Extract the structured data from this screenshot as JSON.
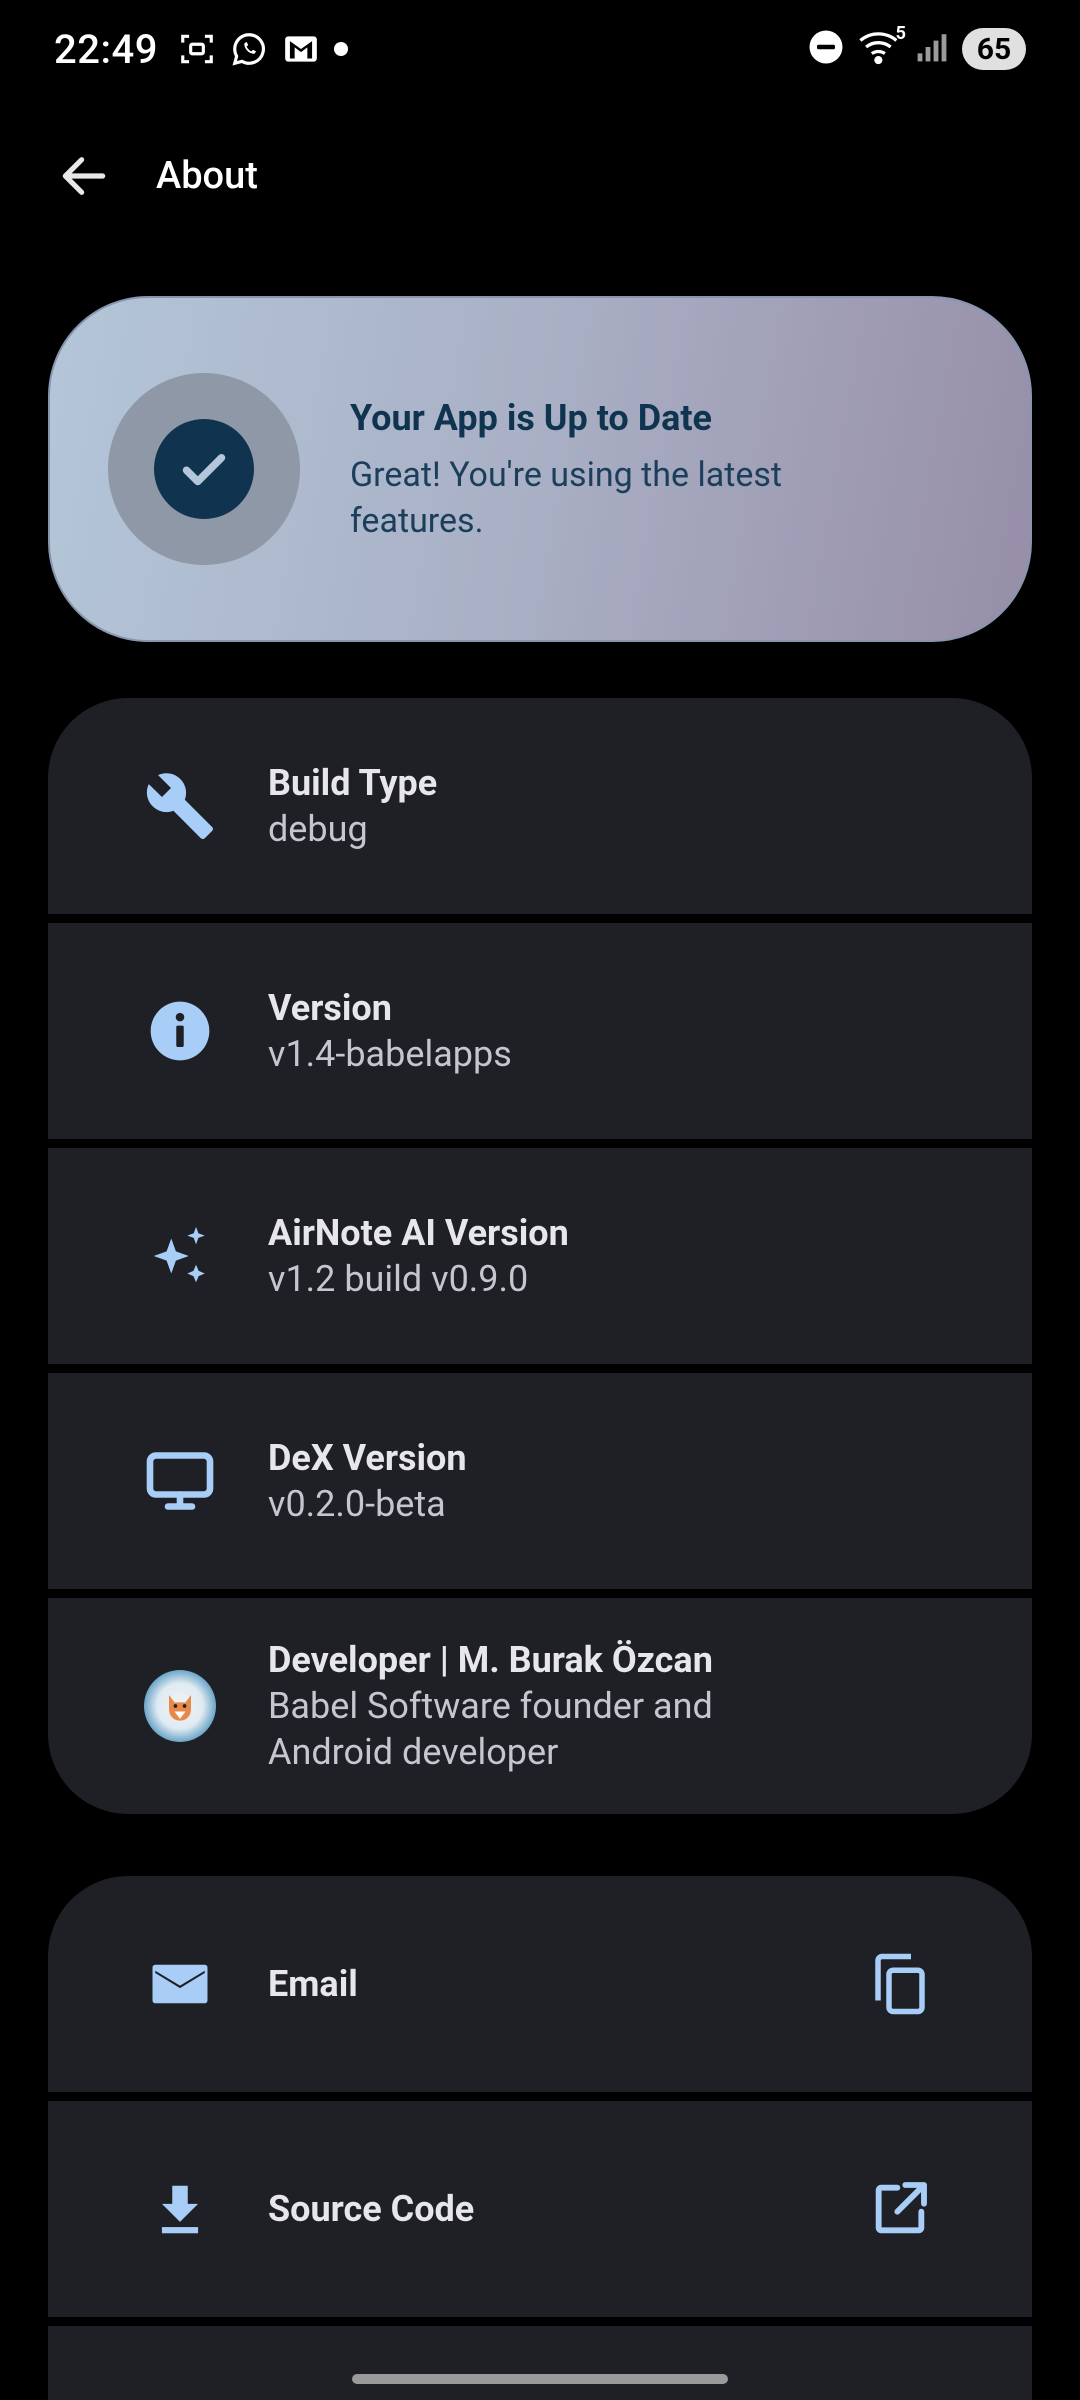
{
  "status_bar": {
    "time": "22:49",
    "left_icons": [
      "screenshot-icon",
      "whatsapp-icon",
      "gmail-icon",
      "dot-icon"
    ],
    "right_icons": [
      "do-not-disturb-icon",
      "wifi-icon",
      "signal-icon"
    ],
    "wifi_badge": "5",
    "battery": "65"
  },
  "app_bar": {
    "title": "About",
    "back_icon": "arrow-back-icon"
  },
  "update_card": {
    "title": "Your App is Up to Date",
    "subtitle": "Great! You're using the latest features.",
    "icon": "check-circle-icon"
  },
  "info_items": [
    {
      "icon": "wrench-icon",
      "title": "Build Type",
      "subtitle": "debug"
    },
    {
      "icon": "info-icon",
      "title": "Version",
      "subtitle": "v1.4-babelapps"
    },
    {
      "icon": "sparkle-icon",
      "title": "AirNote AI Version",
      "subtitle": "v1.2 build v0.9.0"
    },
    {
      "icon": "monitor-icon",
      "title": "DeX Version",
      "subtitle": "v0.2.0-beta"
    },
    {
      "icon": "avatar",
      "title": "Developer | M. Burak Özcan",
      "subtitle": "Babel Software founder and Android developer"
    }
  ],
  "link_items": [
    {
      "icon": "email-icon",
      "title": "Email",
      "trailing_icon": "copy-icon"
    },
    {
      "icon": "download-icon",
      "title": "Source Code",
      "trailing_icon": "open-in-new-icon"
    }
  ],
  "colors": {
    "background": "#000000",
    "surface": "#1E2026",
    "accent_icon": "#A8CDF6",
    "card_gradient_start": "#B4C6D9",
    "card_gradient_end": "#978EA8",
    "card_text": "#0F3450"
  }
}
